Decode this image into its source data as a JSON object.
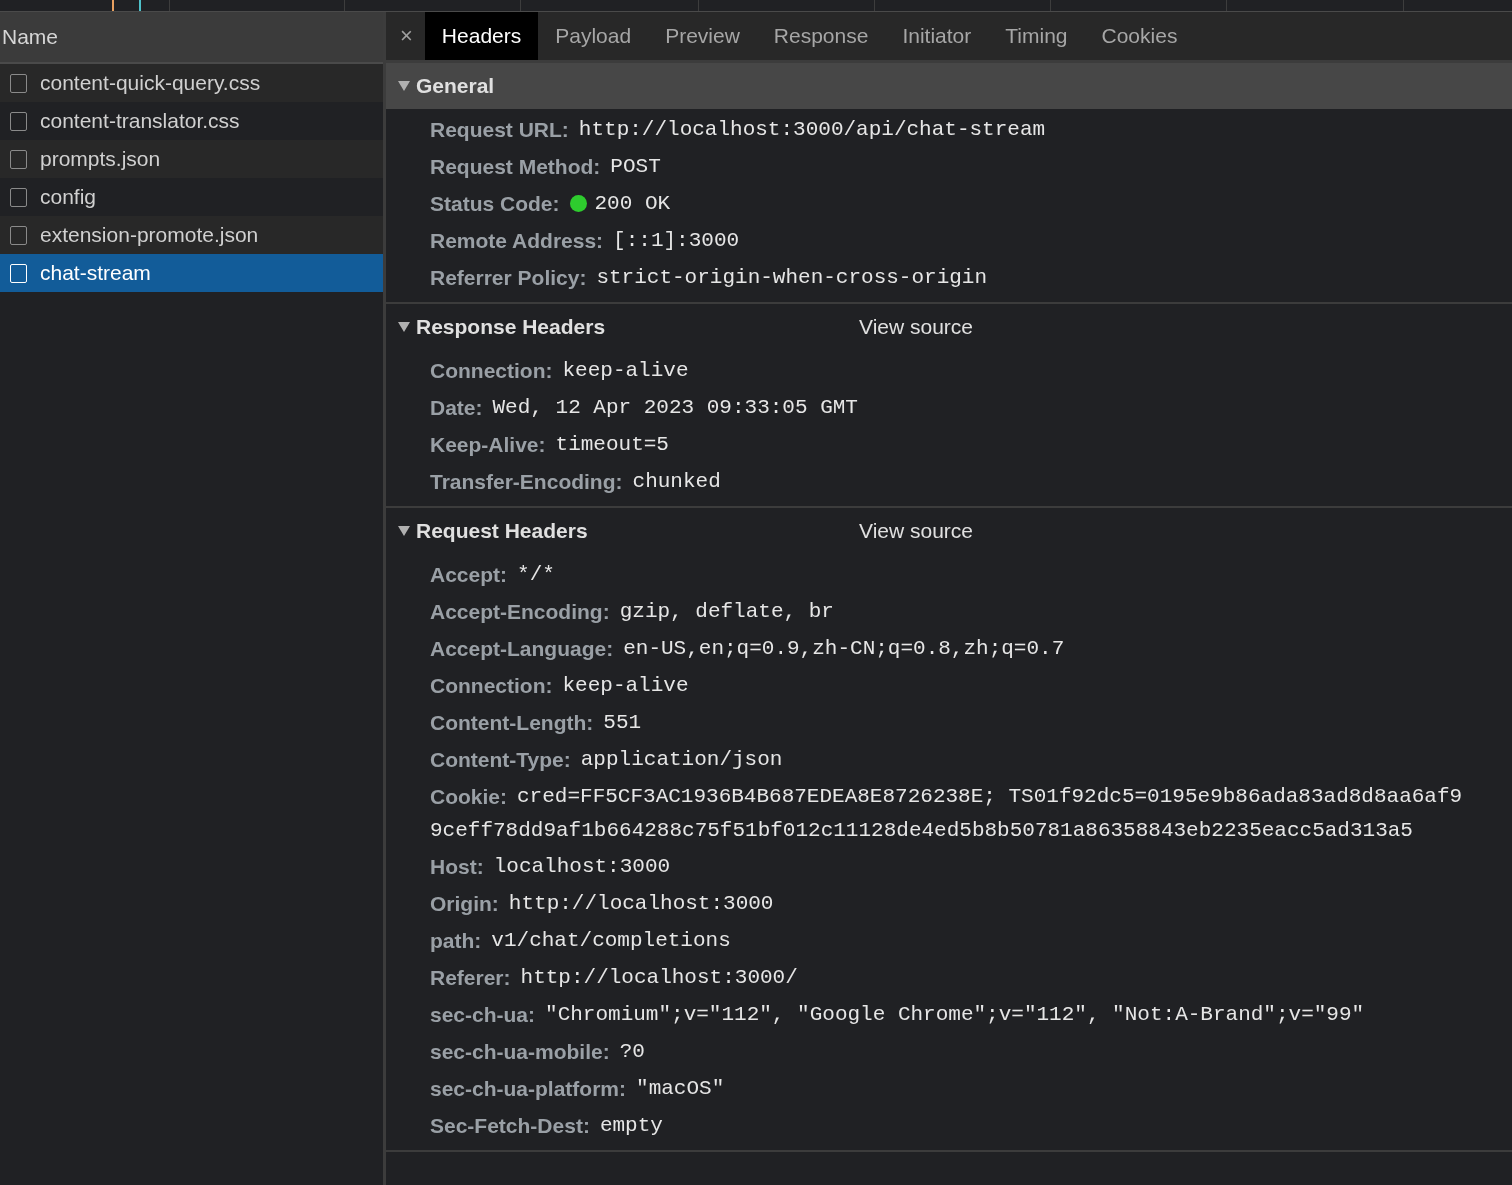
{
  "requests": {
    "column": "Name",
    "rows": [
      {
        "name": "content-quick-query.css",
        "checked": false,
        "selected": false
      },
      {
        "name": "content-translator.css",
        "checked": false,
        "selected": false
      },
      {
        "name": "prompts.json",
        "checked": false,
        "selected": false
      },
      {
        "name": "config",
        "checked": false,
        "selected": false
      },
      {
        "name": "extension-promote.json",
        "checked": false,
        "selected": false
      },
      {
        "name": "chat-stream",
        "checked": false,
        "selected": true
      }
    ]
  },
  "details": {
    "close": "×",
    "tabs": [
      {
        "label": "Headers",
        "selected": true
      },
      {
        "label": "Payload",
        "selected": false
      },
      {
        "label": "Preview",
        "selected": false
      },
      {
        "label": "Response",
        "selected": false
      },
      {
        "label": "Initiator",
        "selected": false
      },
      {
        "label": "Timing",
        "selected": false
      },
      {
        "label": "Cookies",
        "selected": false
      }
    ],
    "sections": [
      {
        "title": "General",
        "kind": "banner",
        "expanded": true,
        "items": [
          {
            "name": "Request URL:",
            "value": "http://localhost:3000/api/chat-stream",
            "kind": "text"
          },
          {
            "name": "Request Method:",
            "value": "POST",
            "kind": "text"
          },
          {
            "name": "Status Code:",
            "value": "200 OK",
            "kind": "status",
            "color": "#2ecc2e"
          },
          {
            "name": "Remote Address:",
            "value": "[::1]:3000",
            "kind": "text"
          },
          {
            "name": "Referrer Policy:",
            "value": "strict-origin-when-cross-origin",
            "kind": "text"
          }
        ]
      },
      {
        "title": "Response Headers",
        "kind": "plain",
        "expanded": true,
        "link": "View source",
        "items": [
          {
            "name": "Connection:",
            "value": "keep-alive",
            "kind": "text"
          },
          {
            "name": "Date:",
            "value": "Wed, 12 Apr 2023 09:33:05 GMT",
            "kind": "text"
          },
          {
            "name": "Keep-Alive:",
            "value": "timeout=5",
            "kind": "text"
          },
          {
            "name": "Transfer-Encoding:",
            "value": "chunked",
            "kind": "text"
          }
        ]
      },
      {
        "title": "Request Headers",
        "kind": "plain",
        "expanded": true,
        "link": "View source",
        "items": [
          {
            "name": "Accept:",
            "value": "*/*",
            "kind": "text"
          },
          {
            "name": "Accept-Encoding:",
            "value": "gzip, deflate, br",
            "kind": "text"
          },
          {
            "name": "Accept-Language:",
            "value": "en-US,en;q=0.9,zh-CN;q=0.8,zh;q=0.7",
            "kind": "text"
          },
          {
            "name": "Connection:",
            "value": "keep-alive",
            "kind": "text"
          },
          {
            "name": "Content-Length:",
            "value": "551",
            "kind": "text"
          },
          {
            "name": "Content-Type:",
            "value": "application/json",
            "kind": "text"
          },
          {
            "name": "Cookie:",
            "value": "cred=FF5CF3AC1936B4B687EDEA8E8726238E; TS01f92dc5=0195e9b86ada83ad8d8aa6af9",
            "continuation": "9ceff78dd9af1b664288c75f51bf012c11128de4ed5b8b50781a86358843eb2235eacc5ad313a5",
            "kind": "text"
          },
          {
            "name": "Host:",
            "value": "localhost:3000",
            "kind": "text"
          },
          {
            "name": "Origin:",
            "value": "http://localhost:3000",
            "kind": "text"
          },
          {
            "name": "path:",
            "value": "v1/chat/completions",
            "kind": "text"
          },
          {
            "name": "Referer:",
            "value": "http://localhost:3000/",
            "kind": "text"
          },
          {
            "name": "sec-ch-ua:",
            "value": "\"Chromium\";v=\"112\", \"Google Chrome\";v=\"112\", \"Not:A-Brand\";v=\"99\"",
            "kind": "text"
          },
          {
            "name": "sec-ch-ua-mobile:",
            "value": "?0",
            "kind": "text"
          },
          {
            "name": "sec-ch-ua-platform:",
            "value": "\"macOS\"",
            "kind": "text"
          },
          {
            "name": "Sec-Fetch-Dest:",
            "value": "empty",
            "kind": "text"
          }
        ]
      }
    ]
  }
}
